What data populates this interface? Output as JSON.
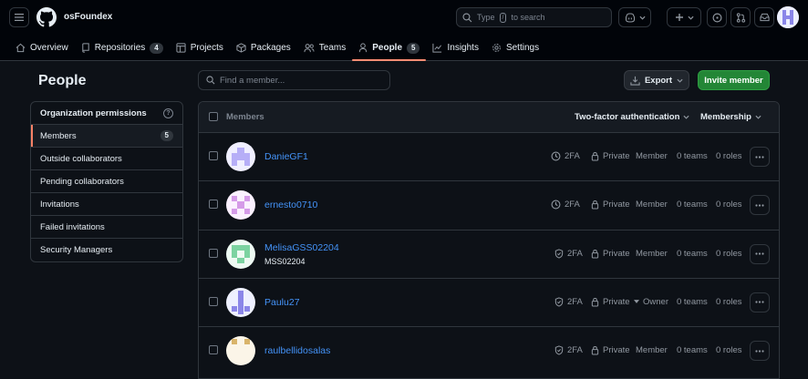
{
  "header": {
    "org_name": "osFoundex",
    "search": {
      "prefix": "Type",
      "key": "/",
      "suffix": "to search"
    }
  },
  "nav": {
    "tabs": [
      {
        "label": "Overview",
        "icon": "home-icon"
      },
      {
        "label": "Repositories",
        "icon": "repo-icon",
        "count": "4"
      },
      {
        "label": "Projects",
        "icon": "table-icon"
      },
      {
        "label": "Packages",
        "icon": "package-icon"
      },
      {
        "label": "Teams",
        "icon": "people-icon"
      },
      {
        "label": "People",
        "icon": "person-icon",
        "count": "5",
        "active": true
      },
      {
        "label": "Insights",
        "icon": "graph-icon"
      },
      {
        "label": "Settings",
        "icon": "gear-icon"
      }
    ]
  },
  "page": {
    "title": "People"
  },
  "sidebar": {
    "heading": "Organization permissions",
    "items": [
      {
        "label": "Members",
        "count": "5",
        "selected": true
      },
      {
        "label": "Outside collaborators"
      },
      {
        "label": "Pending collaborators"
      },
      {
        "label": "Invitations"
      },
      {
        "label": "Failed invitations"
      },
      {
        "label": "Security Managers"
      }
    ]
  },
  "toolbar": {
    "find_placeholder": "Find a member...",
    "export_label": "Export",
    "invite_label": "Invite member"
  },
  "table": {
    "col_members": "Members",
    "filter_2fa": "Two-factor authentication",
    "filter_membership": "Membership",
    "rows": [
      {
        "username": "DanieGF1",
        "fullname": "",
        "twofa": "2FA",
        "twofa_icon": "clock-icon",
        "visibility": "Private",
        "role": "Member",
        "teams": "0 teams",
        "roles": "0 roles",
        "avatar_color": "#b6aef7"
      },
      {
        "username": "ernesto0710",
        "fullname": "",
        "twofa": "2FA",
        "twofa_icon": "clock-icon",
        "visibility": "Private",
        "role": "Member",
        "teams": "0 teams",
        "roles": "0 roles",
        "avatar_color": "#d59be8"
      },
      {
        "username": "MelisaGSS02204",
        "fullname": "MSS02204",
        "twofa": "2FA",
        "twofa_icon": "shield-check-icon",
        "visibility": "Private",
        "role": "Member",
        "teams": "0 teams",
        "roles": "0 roles",
        "avatar_color": "#7cd3a1"
      },
      {
        "username": "Paulu27",
        "fullname": "",
        "twofa": "2FA",
        "twofa_icon": "shield-check-icon",
        "visibility": "Private",
        "visibility_dropdown": true,
        "role": "Owner",
        "teams": "0 teams",
        "roles": "0 roles",
        "avatar_color": "#8b86e8"
      },
      {
        "username": "raulbellidosalas",
        "fullname": "",
        "twofa": "2FA",
        "twofa_icon": "shield-check-icon",
        "visibility": "Private",
        "role": "Member",
        "teams": "0 teams",
        "roles": "0 roles",
        "avatar_color": "#d9b46a"
      }
    ]
  },
  "colors": {
    "accent_tab": "#fd8c73",
    "link": "#4493f8",
    "invite_green": "#238636"
  }
}
